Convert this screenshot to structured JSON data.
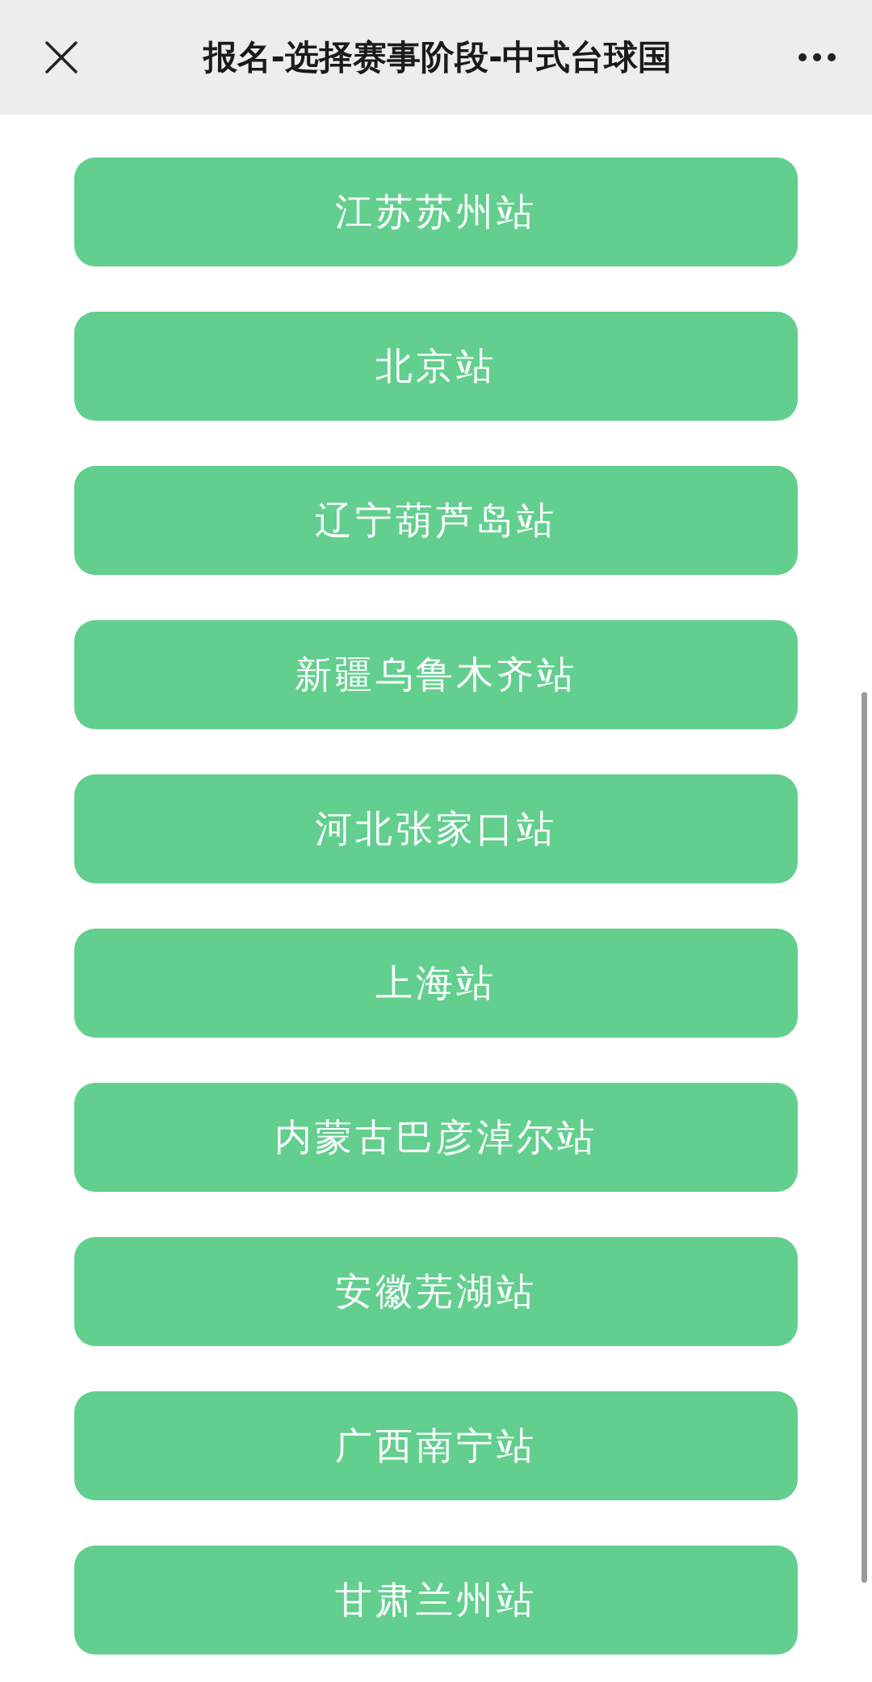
{
  "header": {
    "title": "报名-选择赛事阶段-中式台球国"
  },
  "stations": [
    {
      "label": "江苏苏州站"
    },
    {
      "label": "北京站"
    },
    {
      "label": "辽宁葫芦岛站"
    },
    {
      "label": "新疆乌鲁木齐站"
    },
    {
      "label": "河北张家口站"
    },
    {
      "label": "上海站"
    },
    {
      "label": "内蒙古巴彦淖尔站"
    },
    {
      "label": "安徽芜湖站"
    },
    {
      "label": "广西南宁站"
    },
    {
      "label": "甘肃兰州站"
    }
  ]
}
